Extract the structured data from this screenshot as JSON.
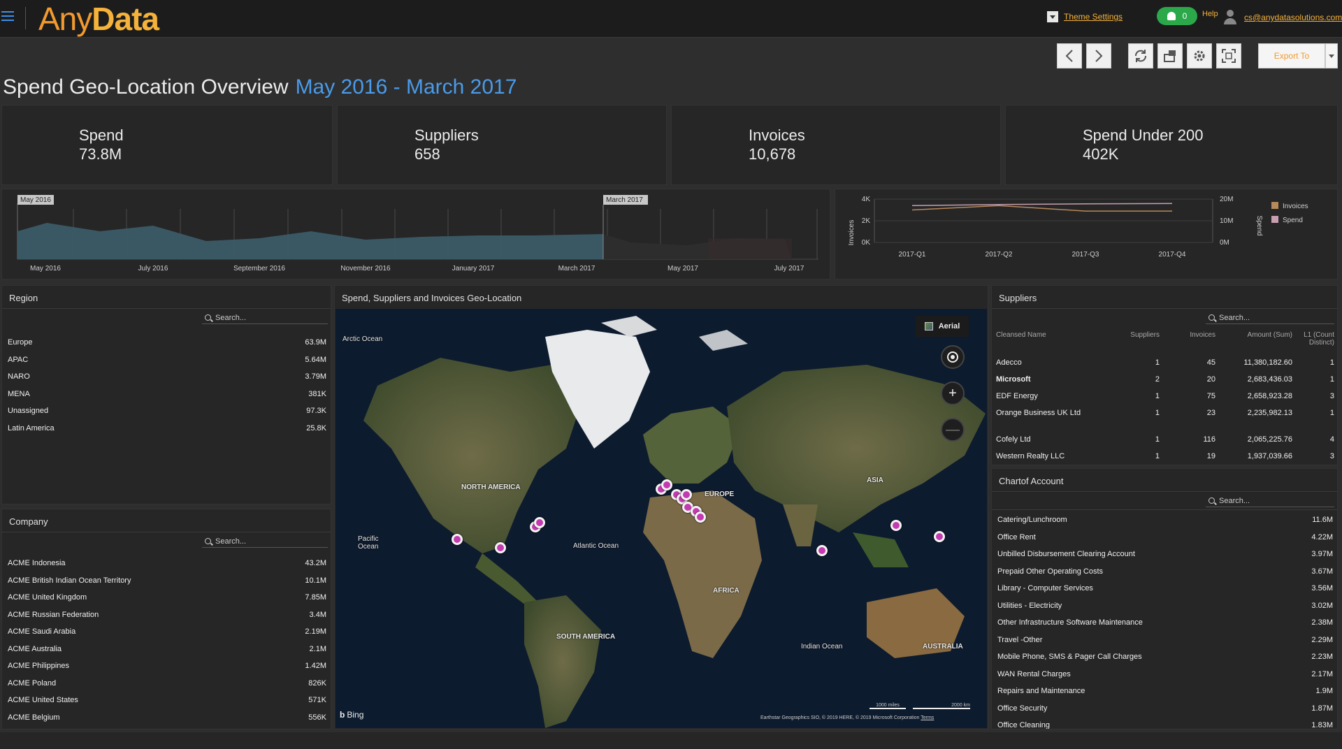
{
  "app": {
    "logo_any": "Any",
    "logo_data": "Data",
    "theme_settings": "Theme Settings",
    "notifications": "0",
    "help": "Help",
    "email": "cs@anydatasolutions.com",
    "export_label": "Export To"
  },
  "page": {
    "title": "Spend Geo-Location Overview",
    "range": "May 2016 - March 2017"
  },
  "kpis": [
    {
      "label": "Spend",
      "value": "73.8M"
    },
    {
      "label": "Suppliers",
      "value": "658"
    },
    {
      "label": "Invoices",
      "value": "10,678"
    },
    {
      "label": "Spend Under 200",
      "value": "402K"
    }
  ],
  "timeline": {
    "start_flag": "May 2016",
    "end_flag": "March 2017",
    "ticks": [
      "May 2016",
      "July 2016",
      "September 2016",
      "November 2016",
      "January 2017",
      "March 2017",
      "May 2017",
      "July 2017"
    ]
  },
  "chart_data": {
    "type": "line",
    "categories": [
      "2017-Q1",
      "2017-Q2",
      "2017-Q3",
      "2017-Q4"
    ],
    "series": [
      {
        "name": "Invoices",
        "axis": "left",
        "color": "#b8895a",
        "values": [
          3000,
          3400,
          2900,
          2900
        ]
      },
      {
        "name": "Spend",
        "axis": "right",
        "color": "#c79fb0",
        "values": [
          17000000,
          17500000,
          17800000,
          18000000
        ]
      }
    ],
    "ylabel": "Invoices",
    "y2label": "Spend",
    "yticks": [
      "0K",
      "2K",
      "4K"
    ],
    "y2ticks": [
      "0M",
      "10M",
      "20M"
    ],
    "ylim": [
      0,
      4000
    ],
    "y2lim": [
      0,
      20000000
    ],
    "legend": "right"
  },
  "region": {
    "title": "Region",
    "search_placeholder": "Search...",
    "rows": [
      {
        "name": "Europe",
        "value": "63.9M"
      },
      {
        "name": "APAC",
        "value": "5.64M"
      },
      {
        "name": "NARO",
        "value": "3.79M"
      },
      {
        "name": "MENA",
        "value": "381K"
      },
      {
        "name": "Unassigned",
        "value": "97.3K"
      },
      {
        "name": "Latin America",
        "value": "25.8K"
      }
    ]
  },
  "company": {
    "title": "Company",
    "search_placeholder": "Search...",
    "rows": [
      {
        "name": "ACME Indonesia",
        "value": "43.2M"
      },
      {
        "name": "ACME British Indian Ocean Territory",
        "value": "10.1M"
      },
      {
        "name": "ACME United Kingdom",
        "value": "7.85M"
      },
      {
        "name": "ACME Russian Federation",
        "value": "3.4M"
      },
      {
        "name": "ACME Saudi Arabia",
        "value": "2.19M"
      },
      {
        "name": "ACME Australia",
        "value": "2.1M"
      },
      {
        "name": "ACME Philippines",
        "value": "1.42M"
      },
      {
        "name": "ACME Poland",
        "value": "826K"
      },
      {
        "name": "ACME United States",
        "value": "571K"
      },
      {
        "name": "ACME Belgium",
        "value": "556K"
      }
    ]
  },
  "map": {
    "title": "Spend, Suppliers and Invoices Geo-Location",
    "aerial": "Aerial",
    "bing": "Bing",
    "attribution": "Earthstar Geographics SIO, © 2019 HERE, © 2019 Microsoft Corporation",
    "terms": "Terms",
    "scale_miles": "1000 miles",
    "scale_km": "2000 km",
    "labels": [
      "Arctic Ocean",
      "NORTH AMERICA",
      "EUROPE",
      "ASIA",
      "Pacific Ocean",
      "Atlantic Ocean",
      "AFRICA",
      "SOUTH AMERICA",
      "Indian Ocean",
      "AUSTRALIA"
    ]
  },
  "suppliers": {
    "title": "Suppliers",
    "search_placeholder": "Search...",
    "headers": [
      "Cleansed Name",
      "Suppliers",
      "Invoices",
      "Amount (Sum)",
      "L1 (Count Distinct)"
    ],
    "rows": [
      {
        "name": "Adecco",
        "suppliers": "1",
        "invoices": "45",
        "amount": "11,380,182.60",
        "l1": "1"
      },
      {
        "name": "Microsoft",
        "suppliers": "2",
        "invoices": "20",
        "amount": "2,683,436.03",
        "l1": "1"
      },
      {
        "name": "EDF Energy",
        "suppliers": "1",
        "invoices": "75",
        "amount": "2,658,923.28",
        "l1": "3"
      },
      {
        "name": "Orange Business UK Ltd",
        "suppliers": "1",
        "invoices": "23",
        "amount": "2,235,982.13",
        "l1": "1"
      },
      {
        "name": "Cofely Ltd",
        "suppliers": "1",
        "invoices": "116",
        "amount": "2,065,225.76",
        "l1": "4"
      },
      {
        "name": "Western Realty LLC",
        "suppliers": "1",
        "invoices": "19",
        "amount": "1,937,039.66",
        "l1": "3"
      }
    ]
  },
  "accounts": {
    "title": "Chartof Account",
    "search_placeholder": "Search...",
    "rows": [
      {
        "name": "Catering/Lunchroom",
        "value": "11.6M"
      },
      {
        "name": "Office Rent",
        "value": "4.22M"
      },
      {
        "name": "Unbilled Disbursement Clearing Account",
        "value": "3.97M"
      },
      {
        "name": "Prepaid Other Operating Costs",
        "value": "3.67M"
      },
      {
        "name": "Library - Computer Services",
        "value": "3.56M"
      },
      {
        "name": "Utilities - Electricity",
        "value": "3.02M"
      },
      {
        "name": "Other Infrastructure Software Maintenance",
        "value": "2.38M"
      },
      {
        "name": "Travel -Other",
        "value": "2.29M"
      },
      {
        "name": "Mobile Phone, SMS & Pager Call Charges",
        "value": "2.23M"
      },
      {
        "name": "WAN Rental Charges",
        "value": "2.17M"
      },
      {
        "name": "Repairs and Maintenance",
        "value": "1.9M"
      },
      {
        "name": "Office Security",
        "value": "1.87M"
      },
      {
        "name": "Office Cleaning",
        "value": "1.83M"
      }
    ]
  }
}
